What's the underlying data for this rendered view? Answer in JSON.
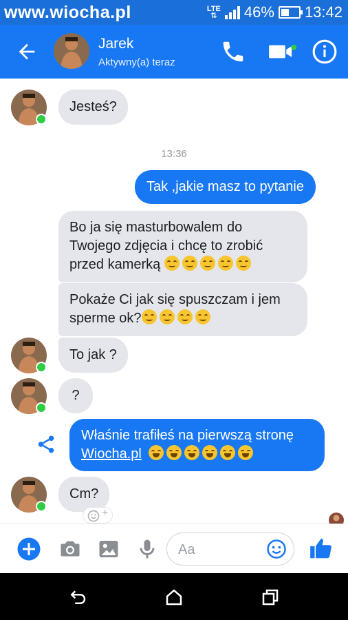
{
  "watermark": "www.wiocha.pl",
  "status_bar": {
    "network": "LTE",
    "battery_percent": "46%",
    "battery_level": 0.46,
    "time": "13:42"
  },
  "header": {
    "name": "Jarek",
    "status": "Aktywny(a) teraz"
  },
  "timestamp": "13:36",
  "messages": {
    "m1": "Jesteś?",
    "m2": "Tak ,jakie masz to pytanie",
    "m3": "Bo ja się masturbowalem do Twojego zdjęcia i chcę to zrobić przed kamerką",
    "m4": "Pokaże Ci jak się spuszczam i jem sperme ok?",
    "m5": "To jak ?",
    "m6": "?",
    "m7_text": "Właśnie trafiłeś na pierwszą stronę",
    "m7_link": "Wiocha.pl",
    "m8": "Cm?"
  },
  "composer": {
    "placeholder": "Aa"
  },
  "colors": {
    "accent": "#1877f2",
    "incoming_bubble": "#e4e6eb",
    "online": "#31cc46"
  },
  "icons": [
    "back-arrow-icon",
    "phone-icon",
    "video-camera-icon",
    "info-icon",
    "share-icon",
    "plus-icon",
    "camera-icon",
    "image-icon",
    "microphone-icon",
    "emoji-icon",
    "thumbs-up-icon",
    "nav-back-icon",
    "nav-home-icon",
    "nav-recents-icon"
  ]
}
